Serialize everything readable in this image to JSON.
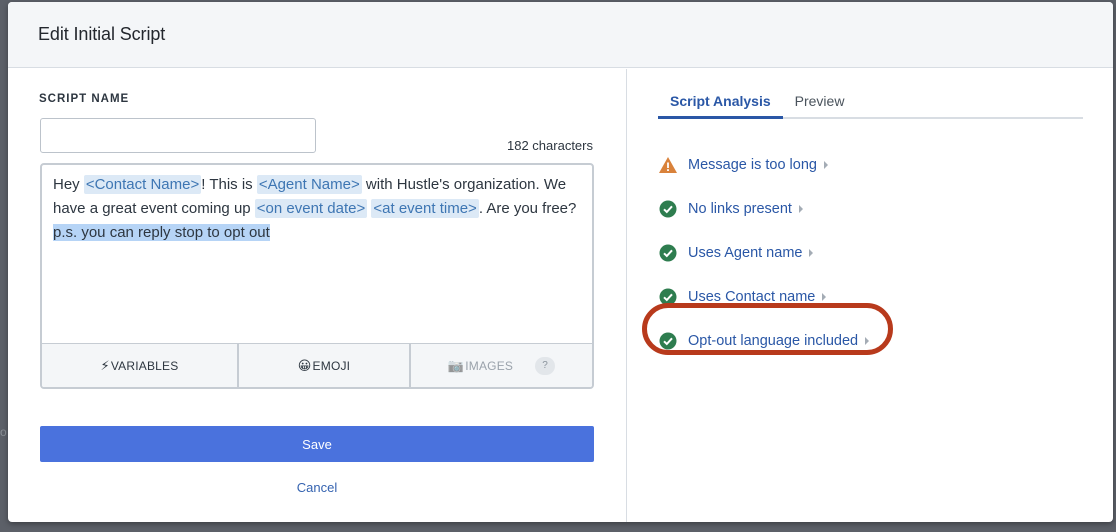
{
  "backdrop": {
    "fragment": "o"
  },
  "modal": {
    "title": "Edit Initial Script"
  },
  "form": {
    "name_label": "SCRIPT NAME",
    "name_value": "",
    "name_placeholder": "",
    "char_count": "182 characters"
  },
  "editor": {
    "segments": [
      {
        "t": "Hey ",
        "type": "text"
      },
      {
        "t": "<Contact Name>",
        "type": "var"
      },
      {
        "t": "! This is ",
        "type": "text"
      },
      {
        "t": "<Agent Name>",
        "type": "var"
      },
      {
        "t": " with Hustle's organization. We have a great event coming up ",
        "type": "text"
      },
      {
        "t": "<on event date>",
        "type": "var"
      },
      {
        "t": " ",
        "type": "text"
      },
      {
        "t": "<at event time>",
        "type": "var"
      },
      {
        "t": ". Are you free?",
        "type": "text"
      },
      {
        "t": "p.s. you can reply stop to opt out",
        "type": "selected",
        "break_before": true
      }
    ],
    "toolbar": {
      "variables_label": "VARIABLES",
      "variables_icon": "⚡",
      "emoji_label": "EMOJI",
      "emoji_icon": "😀",
      "images_label": "IMAGES",
      "images_icon": "📷",
      "help_label": "?"
    }
  },
  "actions": {
    "save_label": "Save",
    "cancel_label": "Cancel"
  },
  "tabs": [
    {
      "label": "Script Analysis",
      "active": true
    },
    {
      "label": "Preview",
      "active": false
    }
  ],
  "analysis": [
    {
      "label": "Message is too long",
      "status": "warning",
      "icon": "warning-icon"
    },
    {
      "label": "No links present",
      "status": "pass",
      "icon": "check-circle-icon"
    },
    {
      "label": "Uses Agent name",
      "status": "pass",
      "icon": "check-circle-icon"
    },
    {
      "label": "Uses Contact name",
      "status": "pass",
      "icon": "check-circle-icon"
    },
    {
      "label": "Opt-out language included",
      "status": "pass",
      "icon": "check-circle-icon",
      "highlighted": true
    }
  ],
  "colors": {
    "accent": "#2a57a6",
    "save_button": "#4a72dd",
    "pass": "#2e7d4f",
    "warning": "#d9823b",
    "highlight_ring": "#b83a1c"
  }
}
